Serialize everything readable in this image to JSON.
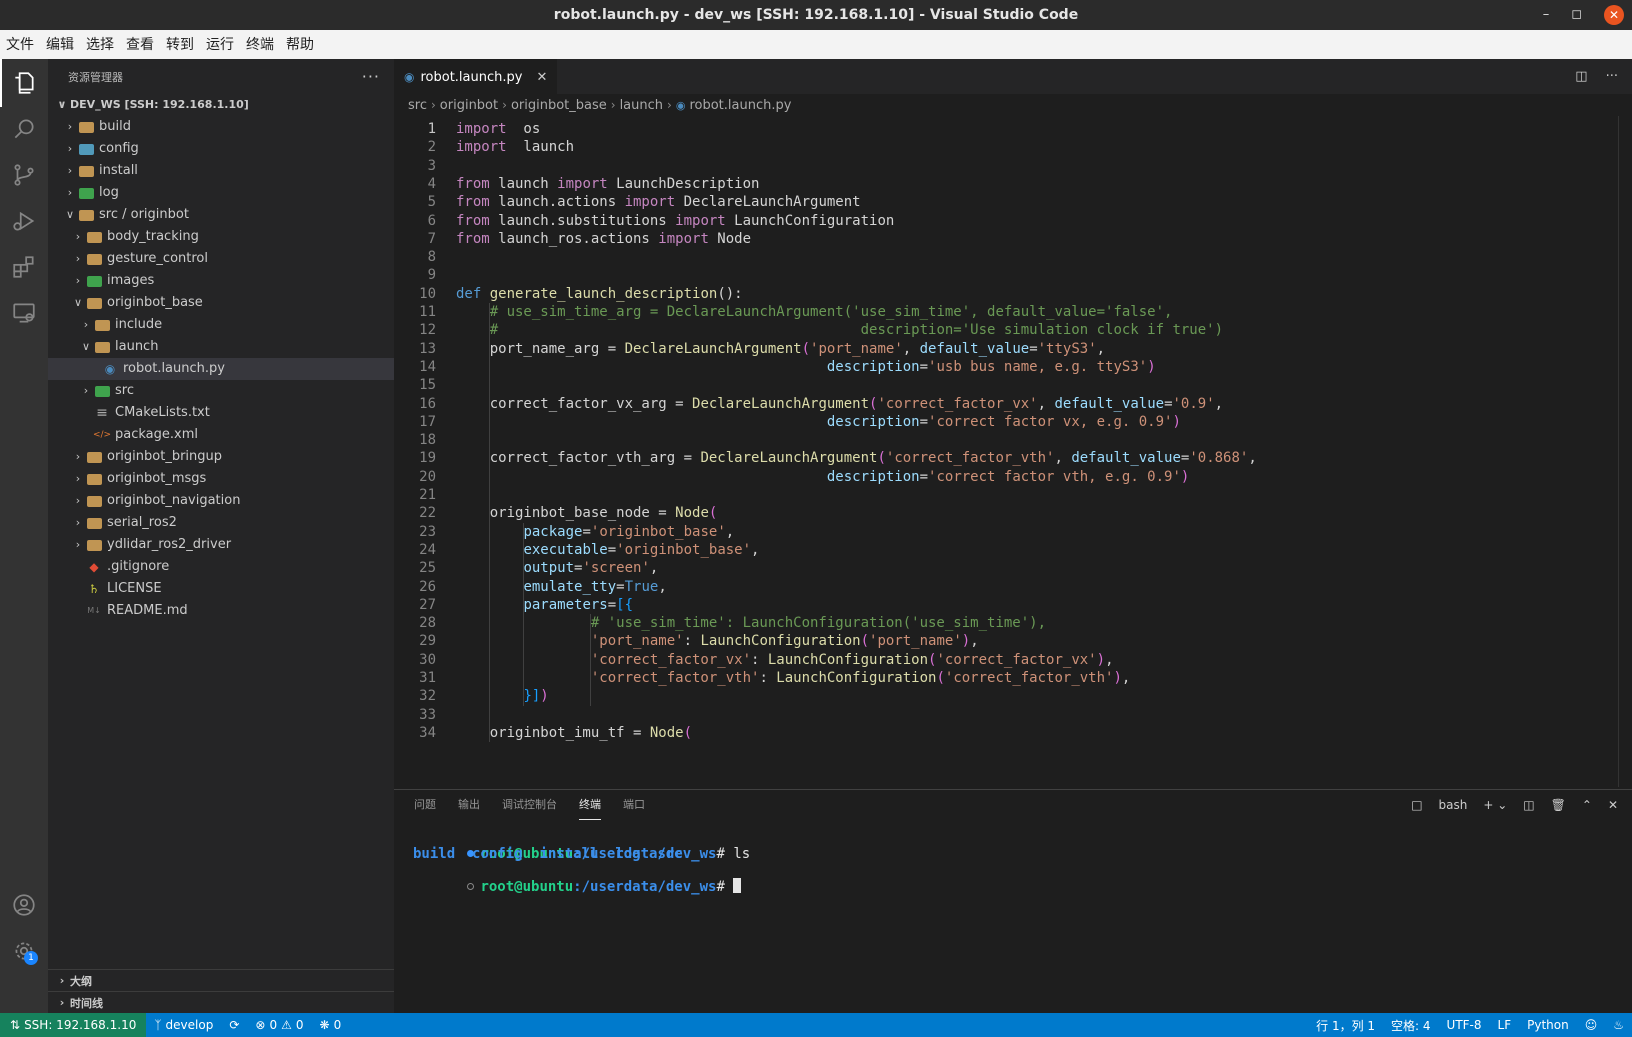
{
  "window": {
    "title": "robot.launch.py - dev_ws [SSH: 192.168.1.10] - Visual Studio Code"
  },
  "menu": [
    "文件",
    "编辑",
    "选择",
    "查看",
    "转到",
    "运行",
    "终端",
    "帮助"
  ],
  "activity": {
    "settings_badge": "1"
  },
  "sidebar": {
    "title": "资源管理器",
    "root": "DEV_WS [SSH: 192.168.1.10]",
    "items": [
      {
        "label": "build",
        "depth": 1,
        "kind": "folder",
        "open": false,
        "color": "#c09553"
      },
      {
        "label": "config",
        "depth": 1,
        "kind": "folder",
        "open": false,
        "color": "#519aba"
      },
      {
        "label": "install",
        "depth": 1,
        "kind": "folder",
        "open": false,
        "color": "#c09553"
      },
      {
        "label": "log",
        "depth": 1,
        "kind": "folder",
        "open": false,
        "color": "#3fa34d"
      },
      {
        "label": "src / originbot",
        "depth": 1,
        "kind": "folder",
        "open": true,
        "color": "#c09553"
      },
      {
        "label": "body_tracking",
        "depth": 2,
        "kind": "folder",
        "open": false,
        "color": "#c09553"
      },
      {
        "label": "gesture_control",
        "depth": 2,
        "kind": "folder",
        "open": false,
        "color": "#c09553"
      },
      {
        "label": "images",
        "depth": 2,
        "kind": "folder",
        "open": false,
        "color": "#3fa34d"
      },
      {
        "label": "originbot_base",
        "depth": 2,
        "kind": "folder",
        "open": true,
        "color": "#c09553"
      },
      {
        "label": "include",
        "depth": 3,
        "kind": "folder",
        "open": false,
        "color": "#c09553"
      },
      {
        "label": "launch",
        "depth": 3,
        "kind": "folder",
        "open": true,
        "color": "#c09553"
      },
      {
        "label": "robot.launch.py",
        "depth": 4,
        "kind": "python",
        "selected": true
      },
      {
        "label": "src",
        "depth": 3,
        "kind": "folder",
        "open": false,
        "color": "#3fa34d"
      },
      {
        "label": "CMakeLists.txt",
        "depth": 3,
        "kind": "text"
      },
      {
        "label": "package.xml",
        "depth": 3,
        "kind": "xml"
      },
      {
        "label": "originbot_bringup",
        "depth": 2,
        "kind": "folder",
        "open": false,
        "color": "#c09553"
      },
      {
        "label": "originbot_msgs",
        "depth": 2,
        "kind": "folder",
        "open": false,
        "color": "#c09553"
      },
      {
        "label": "originbot_navigation",
        "depth": 2,
        "kind": "folder",
        "open": false,
        "color": "#c09553"
      },
      {
        "label": "serial_ros2",
        "depth": 2,
        "kind": "folder",
        "open": false,
        "color": "#c09553"
      },
      {
        "label": "ydlidar_ros2_driver",
        "depth": 2,
        "kind": "folder",
        "open": false,
        "color": "#c09553"
      },
      {
        "label": ".gitignore",
        "depth": 2,
        "kind": "git"
      },
      {
        "label": "LICENSE",
        "depth": 2,
        "kind": "license"
      },
      {
        "label": "README.md",
        "depth": 2,
        "kind": "md"
      }
    ],
    "outline": "大纲",
    "timeline": "时间线"
  },
  "editor": {
    "tab": "robot.launch.py",
    "breadcrumb": [
      "src",
      "originbot",
      "originbot_base",
      "launch",
      "robot.launch.py"
    ],
    "current_line": 1,
    "lines": [
      [
        [
          "kw",
          "import"
        ],
        [
          "",
          "  os"
        ]
      ],
      [
        [
          "kw",
          "import"
        ],
        [
          "",
          "  launch"
        ]
      ],
      [],
      [
        [
          "kw",
          "from"
        ],
        [
          "",
          " launch "
        ],
        [
          "kw",
          "import"
        ],
        [
          "",
          " LaunchDescription"
        ]
      ],
      [
        [
          "kw",
          "from"
        ],
        [
          "",
          " launch.actions "
        ],
        [
          "kw",
          "import"
        ],
        [
          "",
          " DeclareLaunchArgument"
        ]
      ],
      [
        [
          "kw",
          "from"
        ],
        [
          "",
          " launch.substitutions "
        ],
        [
          "kw",
          "import"
        ],
        [
          "",
          " LaunchConfiguration"
        ]
      ],
      [
        [
          "kw",
          "from"
        ],
        [
          "",
          " launch_ros.actions "
        ],
        [
          "kw",
          "import"
        ],
        [
          "",
          " Node"
        ]
      ],
      [],
      [],
      [
        [
          "def",
          "def"
        ],
        [
          "",
          " "
        ],
        [
          "fn",
          "generate_launch_description"
        ],
        [
          "",
          "():"
        ]
      ],
      [
        [
          "",
          "    "
        ],
        [
          "cm",
          "# use_sim_time_arg = DeclareLaunchArgument('use_sim_time', default_value='false',"
        ]
      ],
      [
        [
          "",
          "    "
        ],
        [
          "cm",
          "#                                           description='Use simulation clock if true')"
        ]
      ],
      [
        [
          "",
          "    port_name_arg = "
        ],
        [
          "fn",
          "DeclareLaunchArgument"
        ],
        [
          "br",
          "("
        ],
        [
          "str",
          "'port_name'"
        ],
        [
          "",
          ", "
        ],
        [
          "prm",
          "default_value"
        ],
        [
          "",
          "="
        ],
        [
          "str",
          "'ttyS3'"
        ],
        [
          "",
          ","
        ]
      ],
      [
        [
          "",
          "                                            "
        ],
        [
          "prm",
          "description"
        ],
        [
          "",
          "="
        ],
        [
          "str",
          "'usb bus name, e.g. ttyS3'"
        ],
        [
          "br",
          ")"
        ]
      ],
      [],
      [
        [
          "",
          "    correct_factor_vx_arg = "
        ],
        [
          "fn",
          "DeclareLaunchArgument"
        ],
        [
          "br",
          "("
        ],
        [
          "str",
          "'correct_factor_vx'"
        ],
        [
          "",
          ", "
        ],
        [
          "prm",
          "default_value"
        ],
        [
          "",
          "="
        ],
        [
          "str",
          "'0.9'"
        ],
        [
          "",
          ","
        ]
      ],
      [
        [
          "",
          "                                            "
        ],
        [
          "prm",
          "description"
        ],
        [
          "",
          "="
        ],
        [
          "str",
          "'correct factor vx, e.g. 0.9'"
        ],
        [
          "br",
          ")"
        ]
      ],
      [],
      [
        [
          "",
          "    correct_factor_vth_arg = "
        ],
        [
          "fn",
          "DeclareLaunchArgument"
        ],
        [
          "br",
          "("
        ],
        [
          "str",
          "'correct_factor_vth'"
        ],
        [
          "",
          ", "
        ],
        [
          "prm",
          "default_value"
        ],
        [
          "",
          "="
        ],
        [
          "str",
          "'0.868'"
        ],
        [
          "",
          ","
        ]
      ],
      [
        [
          "",
          "                                            "
        ],
        [
          "prm",
          "description"
        ],
        [
          "",
          "="
        ],
        [
          "str",
          "'correct factor vth, e.g. 0.9'"
        ],
        [
          "br",
          ")"
        ]
      ],
      [],
      [
        [
          "",
          "    originbot_base_node = "
        ],
        [
          "fn",
          "Node"
        ],
        [
          "br",
          "("
        ]
      ],
      [
        [
          "",
          "        "
        ],
        [
          "prm",
          "package"
        ],
        [
          "",
          "="
        ],
        [
          "str",
          "'originbot_base'"
        ],
        [
          "",
          ","
        ]
      ],
      [
        [
          "",
          "        "
        ],
        [
          "prm",
          "executable"
        ],
        [
          "",
          "="
        ],
        [
          "str",
          "'originbot_base'"
        ],
        [
          "",
          ","
        ]
      ],
      [
        [
          "",
          "        "
        ],
        [
          "prm",
          "output"
        ],
        [
          "",
          "="
        ],
        [
          "str",
          "'screen'"
        ],
        [
          "",
          ","
        ]
      ],
      [
        [
          "",
          "        "
        ],
        [
          "prm",
          "emulate_tty"
        ],
        [
          "",
          "="
        ],
        [
          "tr",
          "True"
        ],
        [
          "",
          ","
        ]
      ],
      [
        [
          "",
          "        "
        ],
        [
          "prm",
          "parameters"
        ],
        [
          "",
          "="
        ],
        [
          "br2",
          "[{"
        ]
      ],
      [
        [
          "",
          "                "
        ],
        [
          "cm",
          "# 'use_sim_time': LaunchConfiguration('use_sim_time'),"
        ]
      ],
      [
        [
          "",
          "                "
        ],
        [
          "str",
          "'port_name'"
        ],
        [
          "",
          ": "
        ],
        [
          "fn",
          "LaunchConfiguration"
        ],
        [
          "br",
          "("
        ],
        [
          "str",
          "'port_name'"
        ],
        [
          "br",
          ")"
        ],
        [
          "",
          ","
        ]
      ],
      [
        [
          "",
          "                "
        ],
        [
          "str",
          "'correct_factor_vx'"
        ],
        [
          "",
          ": "
        ],
        [
          "fn",
          "LaunchConfiguration"
        ],
        [
          "br",
          "("
        ],
        [
          "str",
          "'correct_factor_vx'"
        ],
        [
          "br",
          ")"
        ],
        [
          "",
          ","
        ]
      ],
      [
        [
          "",
          "                "
        ],
        [
          "str",
          "'correct_factor_vth'"
        ],
        [
          "",
          ": "
        ],
        [
          "fn",
          "LaunchConfiguration"
        ],
        [
          "br",
          "("
        ],
        [
          "str",
          "'correct_factor_vth'"
        ],
        [
          "br",
          ")"
        ],
        [
          "",
          ","
        ]
      ],
      [
        [
          "",
          "        "
        ],
        [
          "br2",
          "}]"
        ],
        [
          "br",
          ")"
        ]
      ],
      [],
      [
        [
          "",
          "    originbot_imu_tf = "
        ],
        [
          "fn",
          "Node"
        ],
        [
          "br",
          "("
        ]
      ]
    ]
  },
  "panel": {
    "tabs": [
      "问题",
      "输出",
      "调试控制台",
      "终端",
      "端口"
    ],
    "active_tab": "终端",
    "shell": "bash",
    "prompt_user": "root@ubuntu",
    "prompt_path": ":/userdata/dev_ws",
    "prompt_hash": "#",
    "command": " ls",
    "ls_output": [
      "build",
      "config",
      "install",
      "log",
      "src"
    ]
  },
  "status": {
    "remote": "SSH: 192.168.1.10",
    "branch": "develop",
    "errors": "0",
    "warnings": "0",
    "ports": "0",
    "position": "行 1，列 1",
    "spaces": "空格: 4",
    "encoding": "UTF-8",
    "eol": "LF",
    "language": "Python"
  }
}
